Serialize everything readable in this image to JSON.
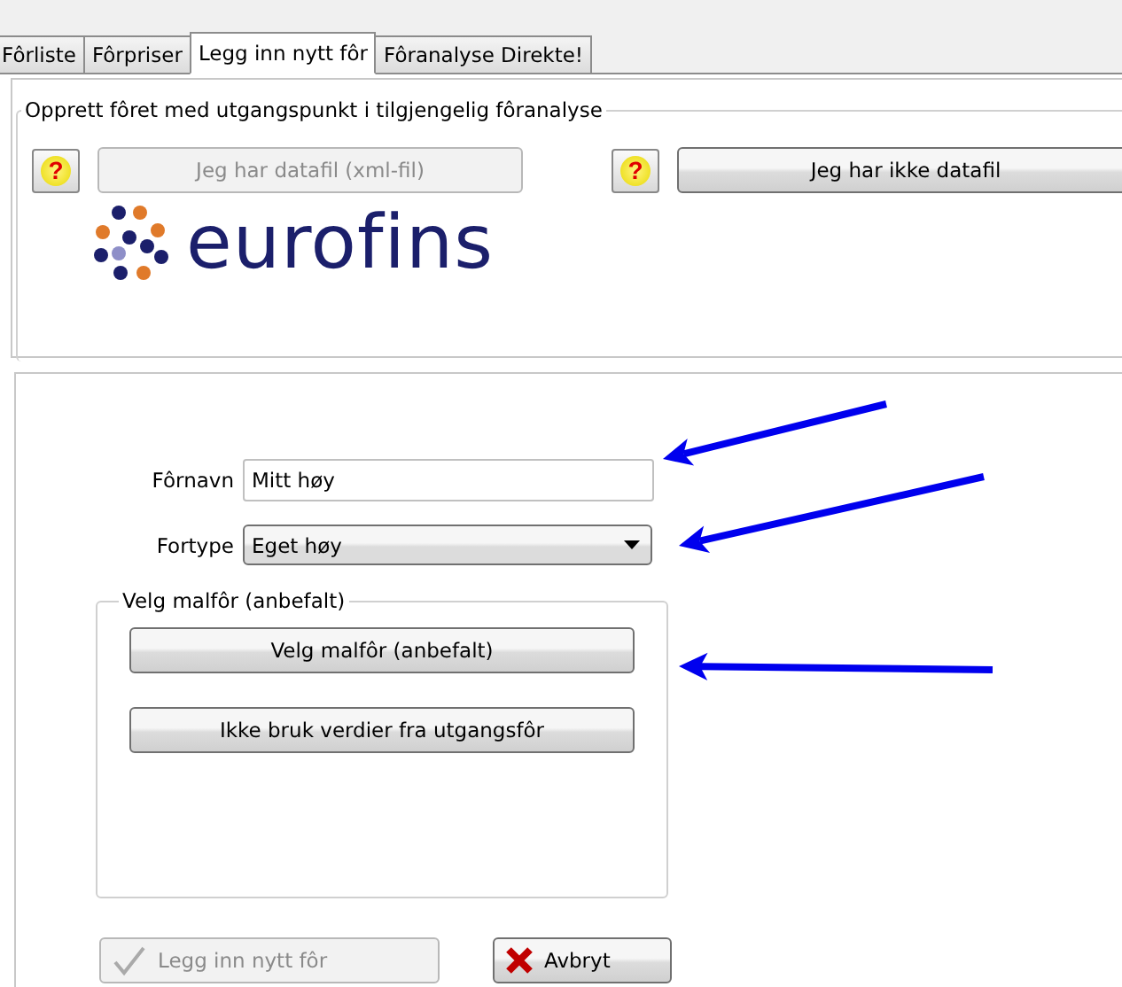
{
  "tabs": [
    {
      "label": "Fôrliste",
      "selected": false
    },
    {
      "label": "Fôrpriser",
      "selected": false
    },
    {
      "label": "Legg inn nytt fôr",
      "selected": true
    },
    {
      "label": "Fôranalyse Direkte!",
      "selected": false
    }
  ],
  "analysis_group": {
    "title": "Opprett fôret med utgangspunkt i tilgjengelig fôranalyse",
    "buttons": [
      {
        "label": "Jeg har datafil (xml-fil)",
        "disabled": true
      },
      {
        "label": "Jeg har ikke datafil",
        "disabled": false
      }
    ],
    "help": [
      "?",
      "?"
    ],
    "logo": "eurofins"
  },
  "form": {
    "name_label": "Fôrnavn",
    "name_value": "Mitt høy",
    "type_label": "Fortype",
    "type_value": "Eget høy"
  },
  "template_group": {
    "title": "Velg malfôr (anbefalt)",
    "buttons": [
      {
        "label": "Velg malfôr (anbefalt)"
      },
      {
        "label": "Ikke bruk verdier fra utgangsfôr"
      }
    ]
  },
  "footer": [
    {
      "label": "Legg inn nytt fôr",
      "kind": "confirm",
      "disabled": true
    },
    {
      "label": "Avbryt",
      "kind": "cancel",
      "disabled": false
    }
  ]
}
